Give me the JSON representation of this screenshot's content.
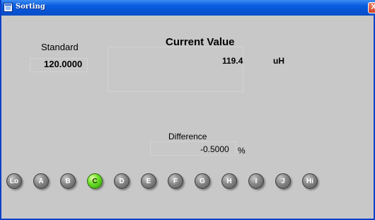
{
  "window": {
    "title": "Sorting",
    "close_glyph": "X"
  },
  "standard": {
    "label": "Standard",
    "value": "120.0000"
  },
  "current": {
    "title": "Current Value",
    "value": "119.4",
    "unit": "uH"
  },
  "difference": {
    "label": "Difference",
    "value": "-0.5000",
    "unit": "%"
  },
  "bins": [
    {
      "label": "Lo",
      "active": false
    },
    {
      "label": "A",
      "active": false
    },
    {
      "label": "B",
      "active": false
    },
    {
      "label": "C",
      "active": true
    },
    {
      "label": "D",
      "active": false
    },
    {
      "label": "E",
      "active": false
    },
    {
      "label": "F",
      "active": false
    },
    {
      "label": "G",
      "active": false
    },
    {
      "label": "H",
      "active": false
    },
    {
      "label": "I",
      "active": false
    },
    {
      "label": "J",
      "active": false
    },
    {
      "label": "Hi",
      "active": false
    }
  ],
  "colors": {
    "active_bin": "#6fe02a",
    "inactive_bin": "#8c8c8c",
    "titlebar": "#0553d3",
    "background": "#c8c8c8"
  }
}
